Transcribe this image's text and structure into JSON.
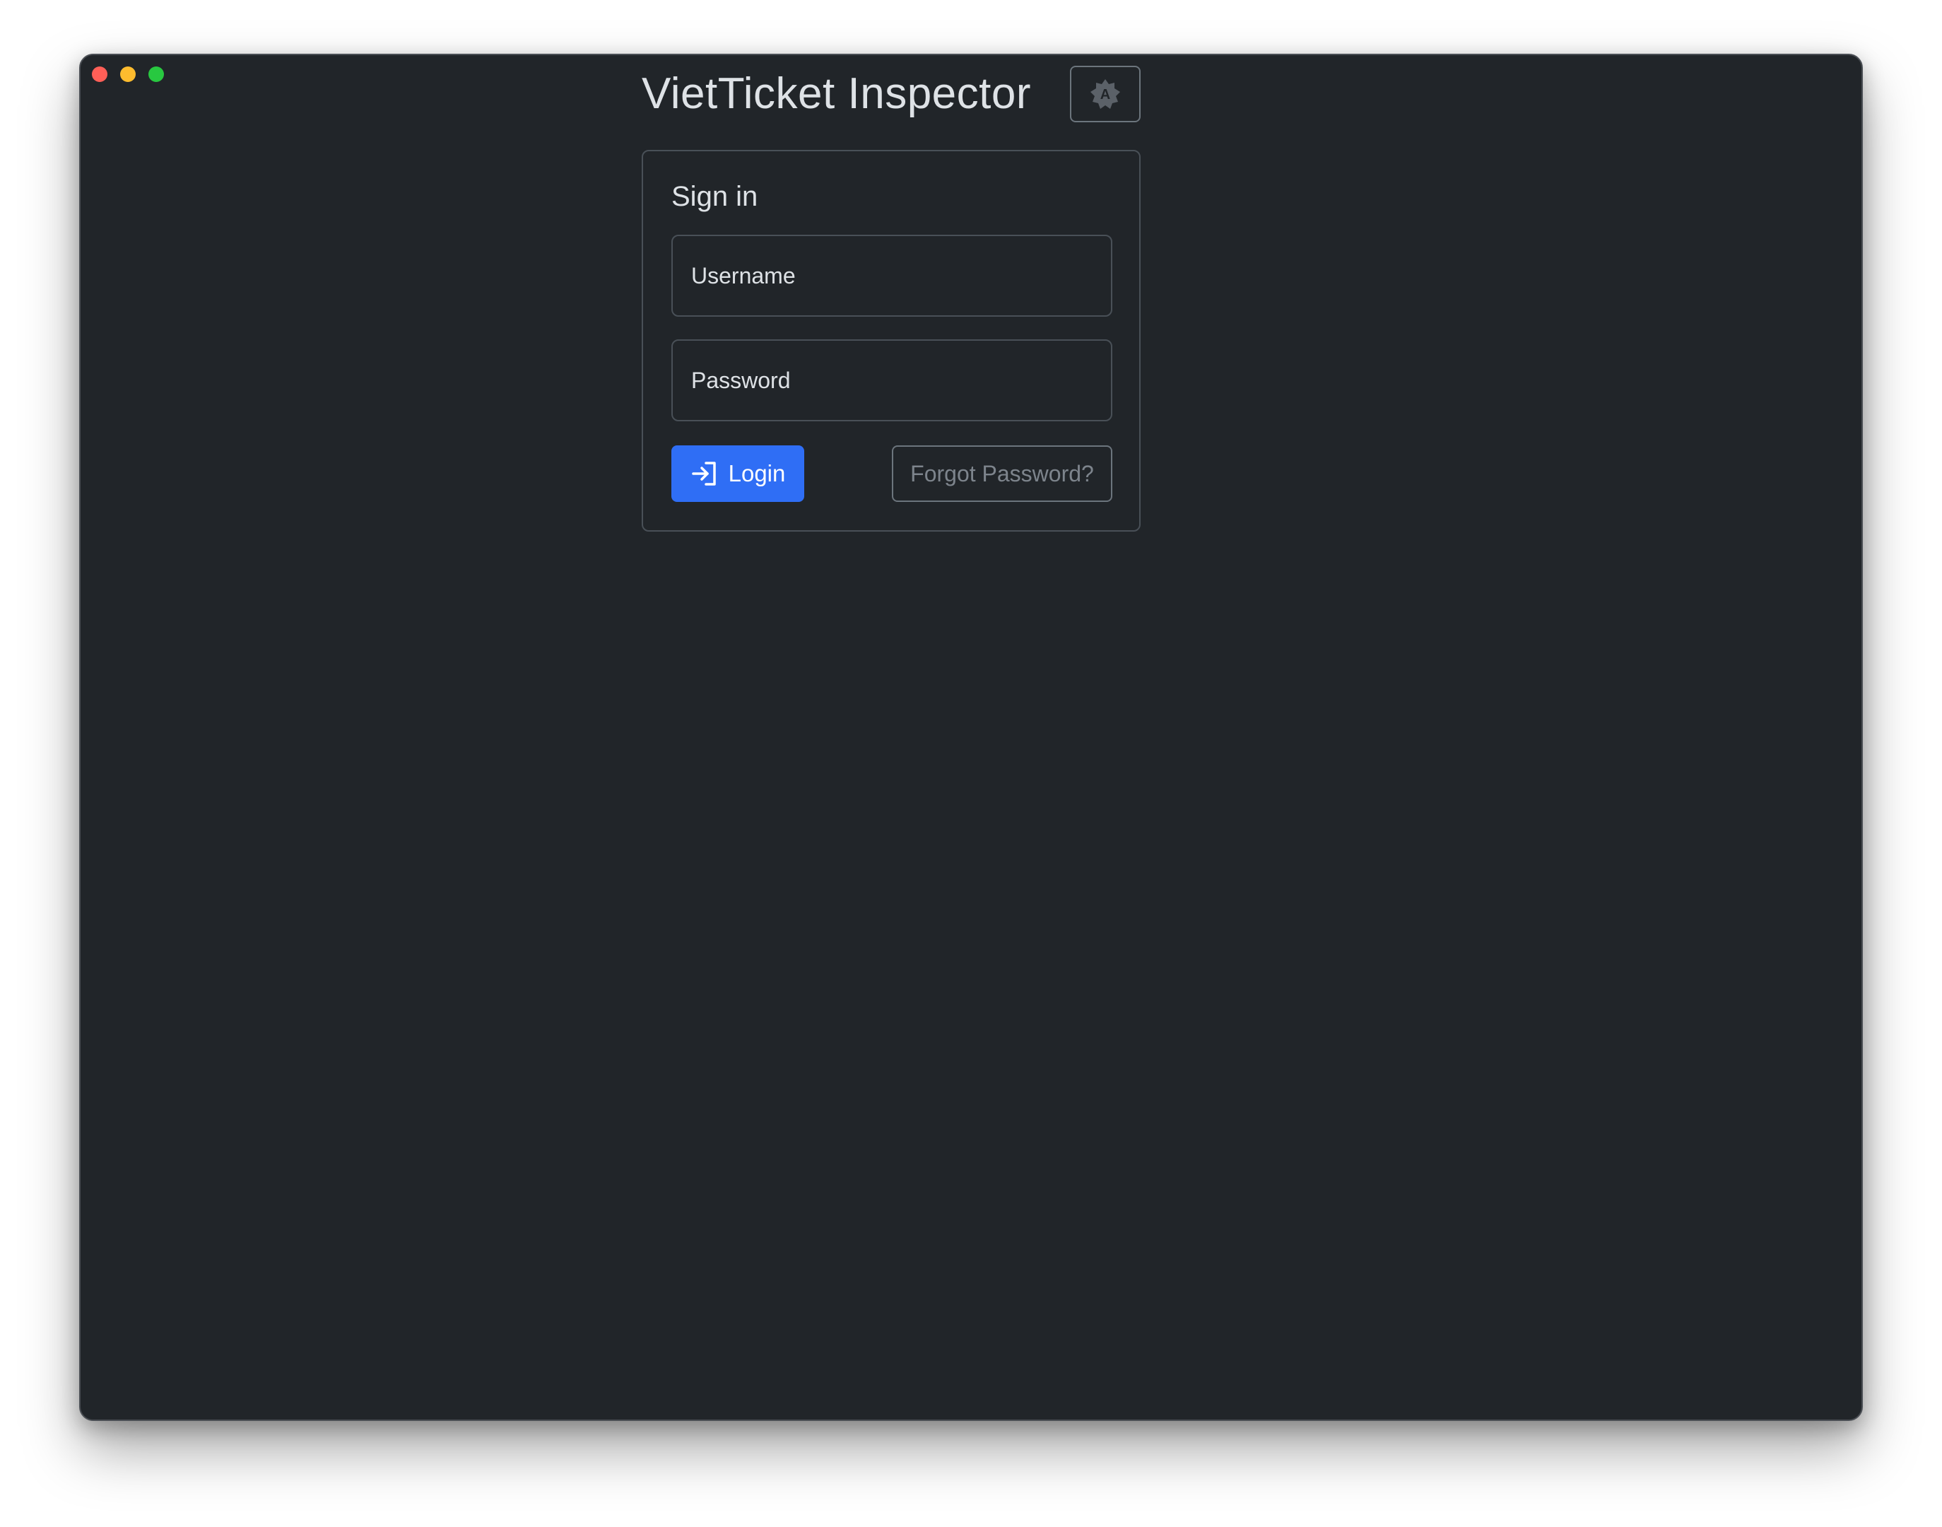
{
  "window": {
    "traffic_lights": [
      "close",
      "minimize",
      "zoom"
    ]
  },
  "header": {
    "title": "VietTicket Inspector",
    "theme_toggle_icon": "auto-theme-icon",
    "theme_toggle_glyph": "A"
  },
  "signin": {
    "title": "Sign in",
    "username_placeholder": "Username",
    "password_placeholder": "Password",
    "login_label": "Login",
    "login_icon": "login-arrow-icon",
    "forgot_label": "Forgot Password?"
  },
  "colors": {
    "background": "#212529",
    "primary": "#2f6ef5",
    "text": "#dee2e6",
    "muted": "#7d848c"
  }
}
